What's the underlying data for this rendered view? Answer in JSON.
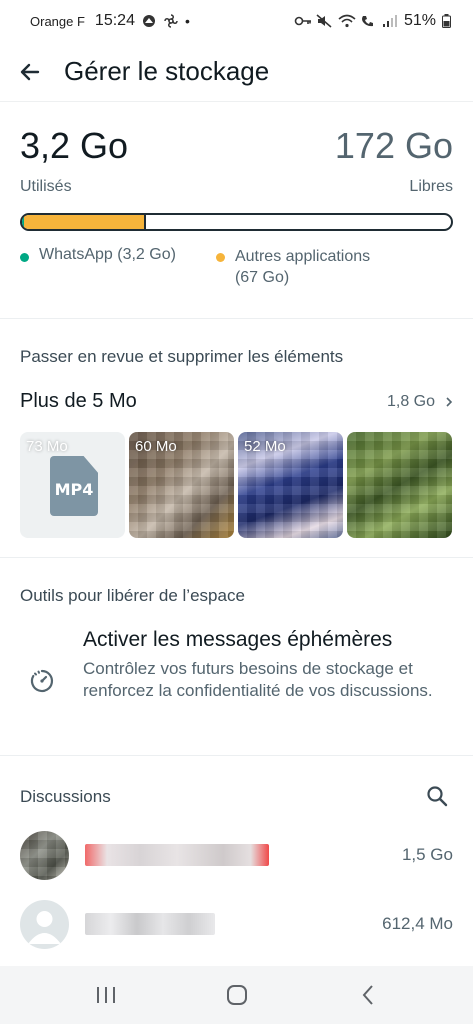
{
  "status_bar": {
    "carrier": "Orange F",
    "time": "15:24",
    "battery": "51%"
  },
  "app_bar": {
    "title": "Gérer le stockage"
  },
  "usage": {
    "used_value": "3,2 Go",
    "used_label": "Utilisés",
    "free_value": "172 Go",
    "free_label": "Libres",
    "whatsapp_fraction": 0.005,
    "other_fraction": 0.285
  },
  "legend": {
    "whatsapp": "WhatsApp (3,2 Go)",
    "other_line1": "Autres applications",
    "other_line2": "(67 Go)"
  },
  "review": {
    "title": "Passer en revue et supprimer les éléments",
    "large_label": "Plus de 5 Mo",
    "large_size": "1,8 Go",
    "thumbs": [
      {
        "size": "73 Mo",
        "type_label": "MP4"
      },
      {
        "size": "60 Mo"
      },
      {
        "size": "52 Mo"
      },
      {
        "size": ""
      }
    ]
  },
  "tools": {
    "title": "Outils pour libérer de l’espace",
    "disappearing_title": "Activer les messages éphémères",
    "disappearing_desc": "Contrôlez vos futurs besoins de stockage et renforcez la confidentialité de vos discussions."
  },
  "discussions": {
    "title": "Discussions",
    "rows": [
      {
        "size": "1,5 Go"
      },
      {
        "size": "612,4 Mo"
      }
    ]
  },
  "colors": {
    "whatsapp_green": "#00a884",
    "other_apps_yellow": "#f6b43b"
  }
}
